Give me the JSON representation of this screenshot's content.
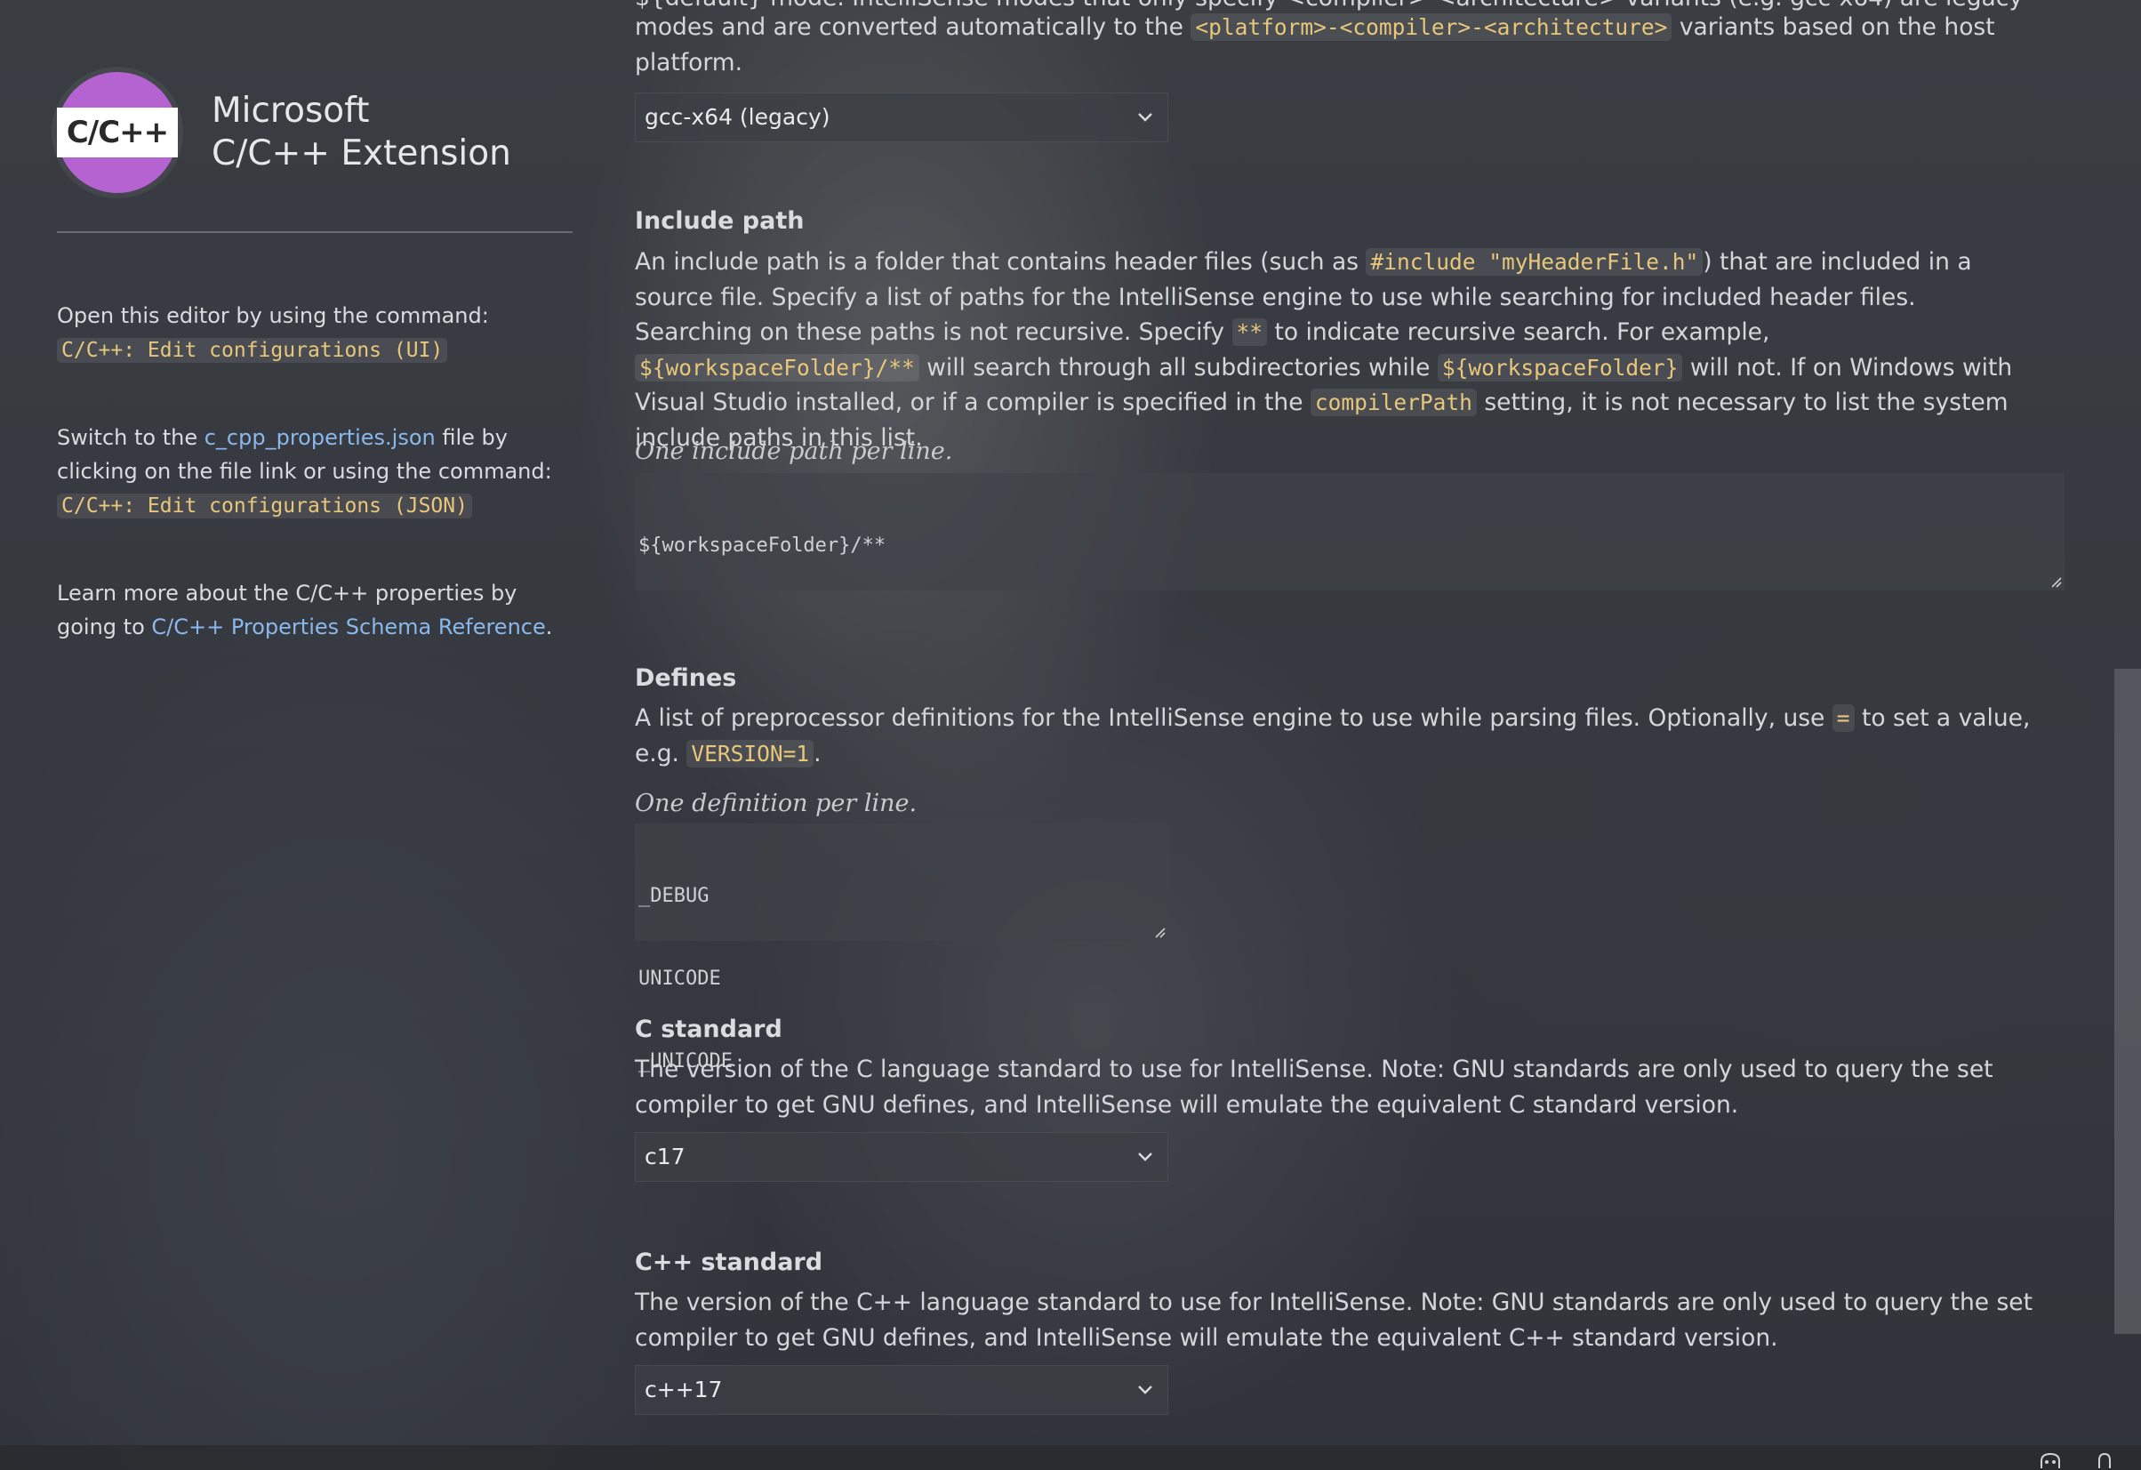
{
  "sidebar": {
    "logo_text": "C/C++",
    "brand_line1": "Microsoft",
    "brand_line2": "C/C++ Extension",
    "open_editor_text": "Open this editor by using the command:",
    "open_editor_command": "C/C++: Edit configurations (UI)",
    "switch_text_1": "Switch to the ",
    "switch_link": "c_cpp_properties.json",
    "switch_text_2": " file by clicking on the file link or using the command:",
    "switch_command": "C/C++: Edit configurations (JSON)",
    "learn_text_1": "Learn more about the C/C++ properties by going to ",
    "learn_link": "C/C++ Properties Schema Reference",
    "learn_text_2": "."
  },
  "intellisense": {
    "top_partial_line": "${default} mode. IntelliSense modes that only specify <compiler>-<architecture> variants (e.g. gcc-x64) are legacy",
    "desc_line2_a": "modes and are converted automatically to the ",
    "desc_line2_code": "<platform>-<compiler>-<architecture>",
    "desc_line2_b": " variants based on the host",
    "desc_line3": "platform.",
    "selected": "gcc-x64 (legacy)"
  },
  "include_path": {
    "title": "Include path",
    "p1": "An include path is a folder that contains header files (such as ",
    "c1": "#include \"myHeaderFile.h\"",
    "p2": ") that are included in a source file. Specify a list of paths for the IntelliSense engine to use while searching for included header files. Searching on these paths is not recursive. Specify ",
    "c2": "**",
    "p3": " to indicate recursive search. For example, ",
    "c3": "${workspaceFolder}/**",
    "p4": " will search through all subdirectories while ",
    "c4": "${workspaceFolder}",
    "p5": " will not. If on Windows with Visual Studio installed, or if a compiler is specified in the ",
    "c5": "compilerPath",
    "p6": " setting, it is not necessary to list the system include paths in this list.",
    "hint": "One include path per line.",
    "value": "${workspaceFolder}/**"
  },
  "defines": {
    "title": "Defines",
    "p1": "A list of preprocessor definitions for the IntelliSense engine to use while parsing files. Optionally, use ",
    "c1": "=",
    "p2": " to set a value, e.g. ",
    "c2": "VERSION=1",
    "p3": ".",
    "hint": "One definition per line.",
    "values": [
      "_DEBUG",
      "UNICODE",
      "_UNICODE"
    ]
  },
  "c_standard": {
    "title": "C standard",
    "desc": "The version of the C language standard to use for IntelliSense. Note: GNU standards are only used to query the set compiler to get GNU defines, and IntelliSense will emulate the equivalent C standard version.",
    "selected": "c17"
  },
  "cpp_standard": {
    "title": "C++ standard",
    "desc": "The version of the C++ language standard to use for IntelliSense. Note: GNU standards are only used to query the set compiler to get GNU defines, and IntelliSense will emulate the equivalent C++ standard version.",
    "selected": "c++17"
  },
  "colors": {
    "code_text": "#e8c77b",
    "link": "#8ab8ea",
    "logo_purple": "#b463d1"
  },
  "icons": [
    "chevron-down-icon",
    "resize-grip-icon",
    "copilot-icon",
    "bell-icon"
  ]
}
